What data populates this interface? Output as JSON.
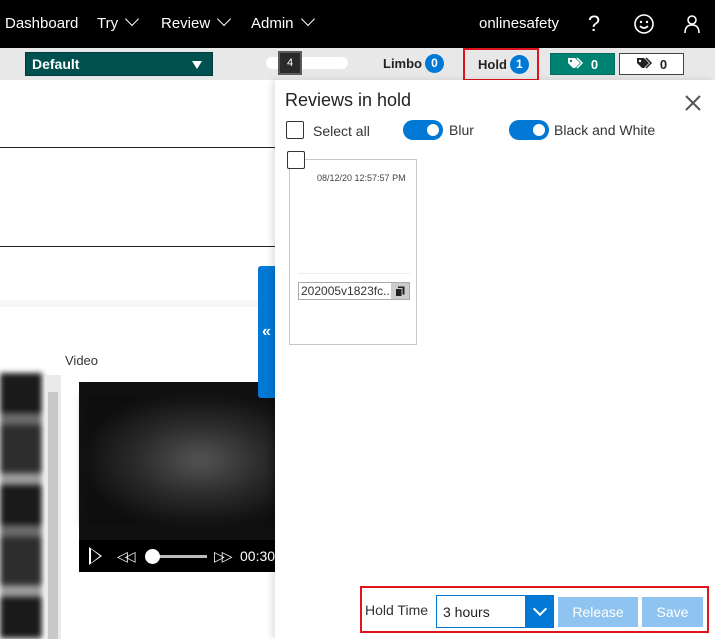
{
  "nav": {
    "items": [
      {
        "label": "Dashboard",
        "dropdown": false
      },
      {
        "label": "Try",
        "dropdown": true
      },
      {
        "label": "Review",
        "dropdown": true
      },
      {
        "label": "Admin",
        "dropdown": true
      }
    ],
    "user": "onlinesafety",
    "help_icon": "?",
    "icons": [
      "help-icon",
      "smiley-icon",
      "person-icon"
    ]
  },
  "toolbar": {
    "team_dropdown": "Default",
    "page_size_value": "4",
    "limbo_label": "Limbo",
    "limbo_count": "0",
    "hold_label": "Hold",
    "hold_count": "1",
    "tag_filled_count": "0",
    "tag_outline_count": "0"
  },
  "left": {
    "video_label": "Video",
    "video_time": "00:30"
  },
  "panel": {
    "title": "Reviews in hold",
    "select_all_label": "Select all",
    "blur_label": "Blur",
    "blur_on": true,
    "bw_label": "Black and White",
    "bw_on": true,
    "items": [
      {
        "date": "08/12/20 12:57:57 PM",
        "name": "202005v1823fc..."
      }
    ]
  },
  "hold": {
    "label": "Hold Time",
    "selected": "3 hours",
    "release_label": "Release",
    "save_label": "Save"
  },
  "colors": {
    "accent": "#0078d4",
    "teal": "#005050",
    "highlight": "#e0141e"
  }
}
